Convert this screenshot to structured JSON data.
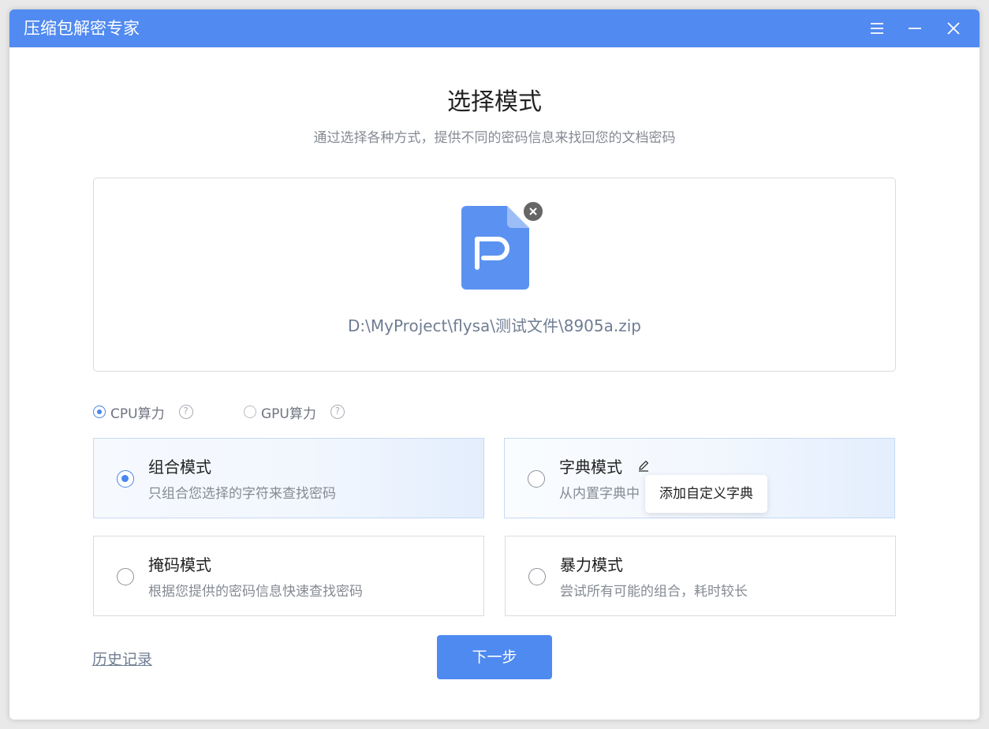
{
  "window": {
    "title": "压缩包解密专家",
    "controls": {
      "menu_icon": "menu-icon",
      "minimize_icon": "minimize-icon",
      "close_icon": "close-icon"
    }
  },
  "header": {
    "title": "选择模式",
    "subtitle": "通过选择各种方式，提供不同的密码信息来找回您的文档密码"
  },
  "file": {
    "path": "D:\\MyProject\\flysa\\测试文件\\8905a.zip",
    "icon": "document-p-icon",
    "remove_icon": "remove-file-icon"
  },
  "compute": {
    "options": [
      {
        "label": "CPU算力",
        "selected": true,
        "help": "?"
      },
      {
        "label": "GPU算力",
        "selected": false,
        "help": "?"
      }
    ]
  },
  "modes": [
    {
      "name": "组合模式",
      "description": "只组合您选择的字符来查找密码",
      "selected": true
    },
    {
      "name": "字典模式",
      "description": "从内置字典中",
      "selected": false
    },
    {
      "name": "掩码模式",
      "description": "根据您提供的密码信息快速查找密码",
      "selected": false
    },
    {
      "name": "暴力模式",
      "description": "尝试所有可能的组合，耗时较长",
      "selected": false
    }
  ],
  "tooltip": {
    "text": "添加自定义字典"
  },
  "footer": {
    "history_label": "历史记录",
    "next_label": "下一步"
  },
  "colors": {
    "titlebar": "#518af0",
    "accent": "#4a86ee",
    "primary_button": "#4e8af0"
  }
}
